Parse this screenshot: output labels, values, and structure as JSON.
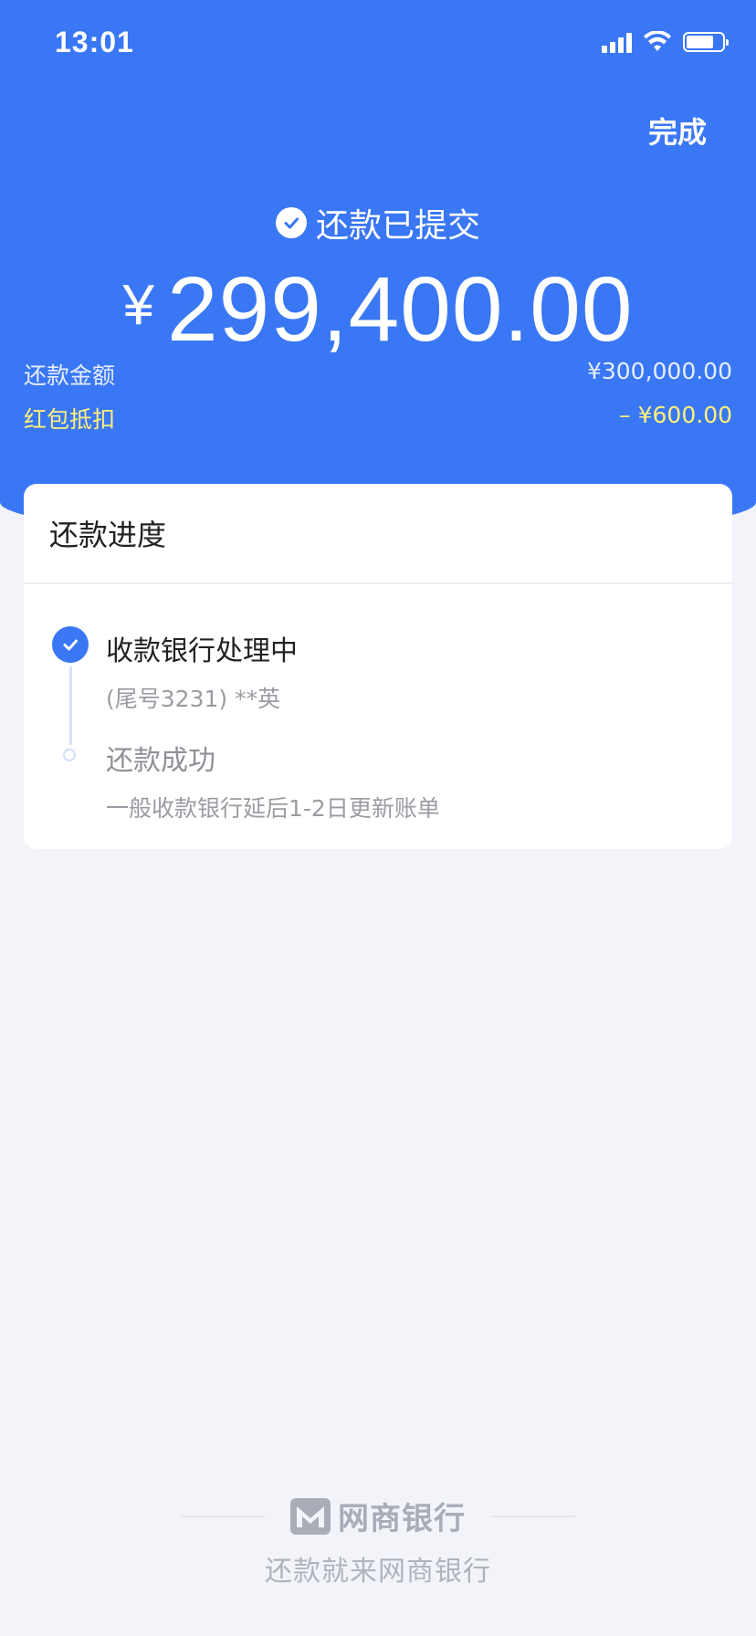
{
  "status_bar": {
    "time": "13:01"
  },
  "header": {
    "done_label": "完成",
    "status_text": "还款已提交",
    "currency_symbol": "¥",
    "amount": "299,400.00",
    "details": [
      {
        "label": "还款金额",
        "value": "¥300,000.00"
      },
      {
        "label": "红包抵扣",
        "value": "– ¥600.00"
      }
    ]
  },
  "progress": {
    "title": "还款进度",
    "steps": [
      {
        "title": "收款银行处理中",
        "subtitle": "(尾号3231) **英",
        "done": true
      },
      {
        "title": "还款成功",
        "subtitle": "一般收款银行延后1-2日更新账单",
        "done": false
      }
    ]
  },
  "footer": {
    "logo_text": "网商银行",
    "slogan": "还款就来网商银行"
  },
  "colors": {
    "brand_blue": "#3a77f4",
    "discount_yellow": "#fff07a",
    "background": "#f3f4f9"
  },
  "icons": [
    "signal-icon",
    "wifi-icon",
    "battery-icon",
    "check-circle-icon",
    "step-check-icon",
    "step-pending-dot-icon",
    "mybank-logo-icon"
  ]
}
